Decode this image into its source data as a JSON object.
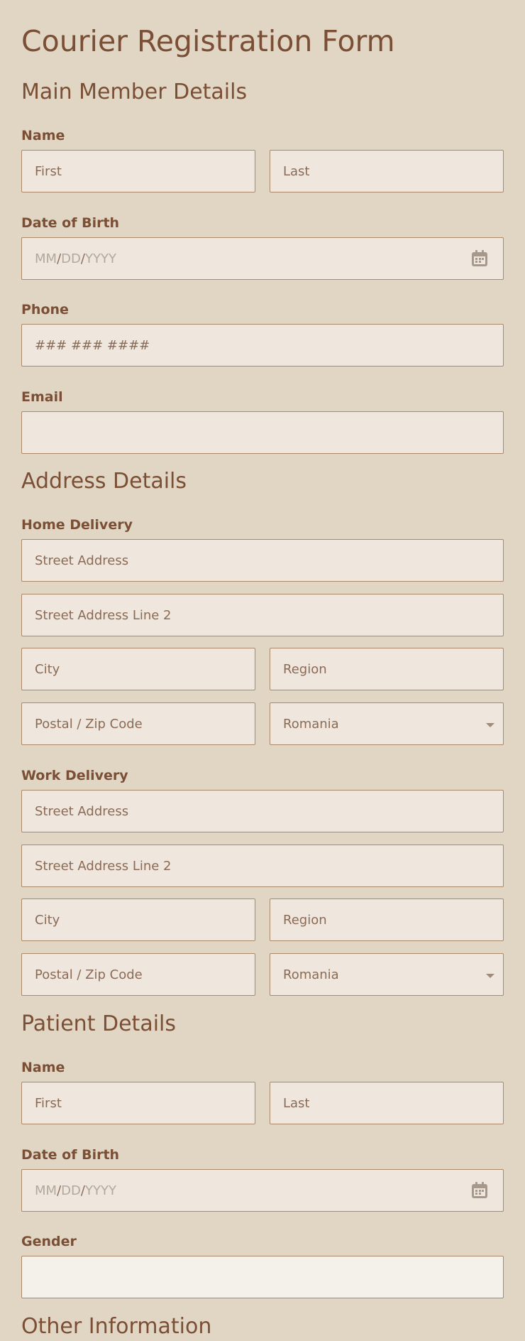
{
  "form": {
    "title": "Courier Registration Form"
  },
  "main_member": {
    "heading": "Main Member Details",
    "name_label": "Name",
    "first_placeholder": "First",
    "last_placeholder": "Last",
    "dob_label": "Date of Birth",
    "dob_parts": {
      "mm": "MM",
      "sep1": "/",
      "dd": "DD",
      "sep2": "/",
      "yyyy": "YYYY"
    },
    "phone_label": "Phone",
    "phone_placeholder": "### ### ####",
    "email_label": "Email",
    "email_value": ""
  },
  "address": {
    "heading": "Address Details",
    "home": {
      "label": "Home Delivery",
      "street": "Street Address",
      "street2": "Street Address Line 2",
      "city": "City",
      "region": "Region",
      "postal": "Postal / Zip Code",
      "country": "Romania"
    },
    "work": {
      "label": "Work Delivery",
      "street": "Street Address",
      "street2": "Street Address Line 2",
      "city": "City",
      "region": "Region",
      "postal": "Postal / Zip Code",
      "country": "Romania"
    }
  },
  "patient": {
    "heading": "Patient Details",
    "name_label": "Name",
    "first_placeholder": "First",
    "last_placeholder": "Last",
    "dob_label": "Date of Birth",
    "dob_parts": {
      "mm": "MM",
      "sep1": "/",
      "dd": "DD",
      "sep2": "/",
      "yyyy": "YYYY"
    },
    "gender_label": "Gender",
    "gender_value": ""
  },
  "other": {
    "heading": "Other Information"
  },
  "icons": {
    "calendar": "calendar-icon",
    "dropdown": "chevron-down-icon"
  },
  "colors": {
    "background": "#e1d6c4",
    "text": "#7a4f35",
    "field_bg": "#efe7dd",
    "field_border": "#a9896a"
  }
}
